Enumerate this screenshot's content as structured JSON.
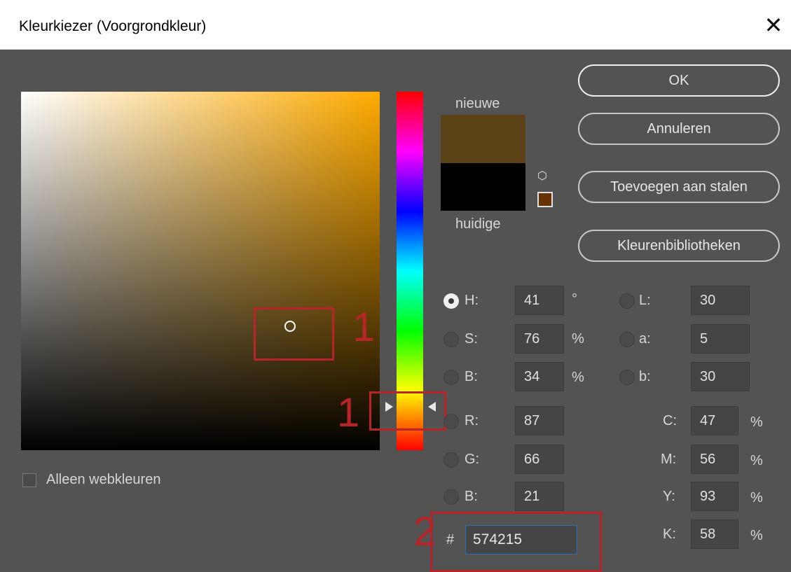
{
  "window": {
    "title": "Kleurkiezer (Voorgrondkleur)",
    "close_glyph": "✕"
  },
  "preview": {
    "new_label": "nieuwe",
    "current_label": "huidige",
    "new_color": "#5a4216",
    "current_color": "#000000"
  },
  "buttons": {
    "ok": "OK",
    "cancel": "Annuleren",
    "add_swatch": "Toevoegen aan stalen",
    "libraries": "Kleurenbibliotheken"
  },
  "web_colors": {
    "label": "Alleen webkleuren",
    "checked": false
  },
  "hsb": {
    "h_label": "H:",
    "h": "41",
    "h_unit": "°",
    "s_label": "S:",
    "s": "76",
    "s_unit": "%",
    "b_label": "B:",
    "b": "34",
    "b_unit": "%",
    "selected": "H"
  },
  "lab": {
    "l_label": "L:",
    "l": "30",
    "a_label": "a:",
    "a": "5",
    "b_label": "b:",
    "b": "30"
  },
  "rgb": {
    "r_label": "R:",
    "r": "87",
    "g_label": "G:",
    "g": "66",
    "b_label": "B:",
    "b": "21"
  },
  "cmyk": {
    "c_label": "C:",
    "c": "47",
    "m_label": "M:",
    "m": "56",
    "y_label": "Y:",
    "y": "93",
    "k_label": "K:",
    "k": "58",
    "unit": "%"
  },
  "hex": {
    "label": "#",
    "value": "574215"
  },
  "annotations": {
    "n1": "1",
    "n2": "1",
    "n3": "2"
  }
}
